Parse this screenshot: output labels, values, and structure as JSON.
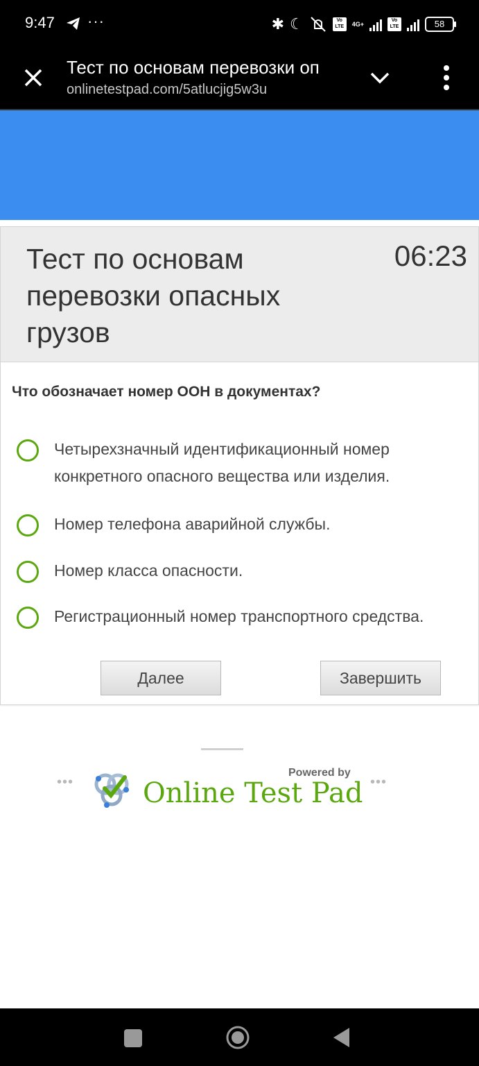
{
  "status_bar": {
    "time": "9:47",
    "dots": "···",
    "battery": "58",
    "network_label": "4G+",
    "volte_label": "Vo LTE",
    "icons": [
      "telegram-icon",
      "bluetooth-icon",
      "moon-icon",
      "mute-icon",
      "signal-icon",
      "battery-icon"
    ]
  },
  "browser": {
    "title": "Тест по основам перевозки оп",
    "url": "onlinetestpad.com/5atlucjig5w3u"
  },
  "test": {
    "title": "Тест по основам перевозки опасных грузов",
    "timer": "06:23",
    "question": "Что обозначает номер ООН  в документах?",
    "options": [
      "Четырехзначный идентификационный номер конкретного опасного вещества или изделия.",
      "Номер телефона аварийной службы.",
      "Номер класса опасности.",
      "Регистрационный номер транспортного средства."
    ],
    "next_label": "Далее",
    "finish_label": "Завершить"
  },
  "footer": {
    "powered_by": "Powered by",
    "brand": "Online Test Pad"
  },
  "colors": {
    "accent_blue": "#3b8eef",
    "radio_green": "#5aa80e",
    "brand_green": "#5aa80e"
  }
}
